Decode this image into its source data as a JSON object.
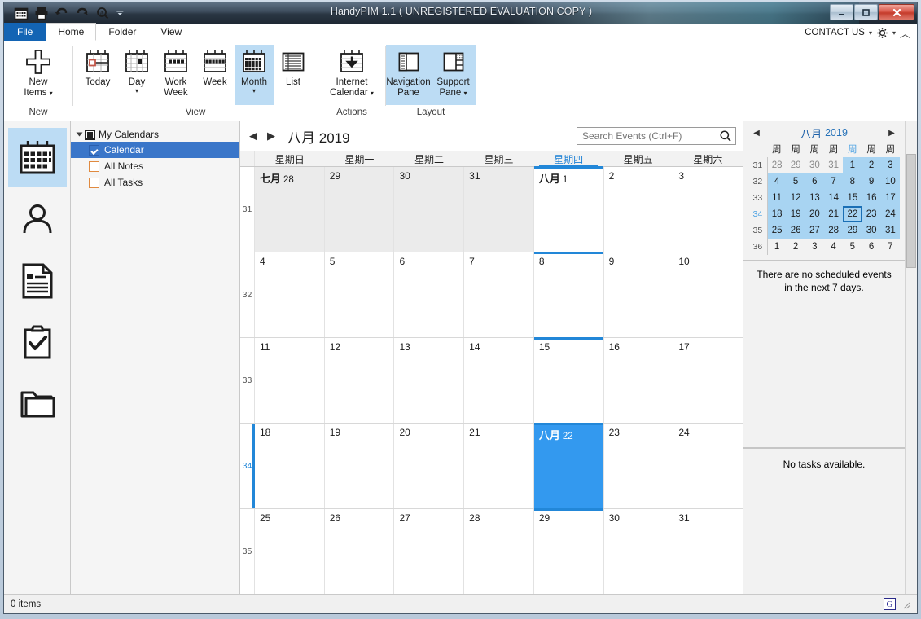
{
  "window": {
    "title": "HandyPIM 1.1 ( UNREGISTERED EVALUATION COPY )",
    "minimize": "—",
    "maximize": "❐",
    "close": "✕"
  },
  "quick_access": [
    {
      "name": "calendar-icon",
      "tip": "Calendar"
    },
    {
      "name": "print-icon",
      "tip": "Print"
    },
    {
      "name": "undo-icon",
      "tip": "Undo"
    },
    {
      "name": "redo-icon",
      "tip": "Redo"
    },
    {
      "name": "find-icon",
      "tip": "Find"
    },
    {
      "name": "customize-qat-icon",
      "tip": "Customize Quick Access Toolbar"
    }
  ],
  "tabs": [
    {
      "label": "File",
      "id": "file",
      "active": false
    },
    {
      "label": "Home",
      "id": "home",
      "active": true
    },
    {
      "label": "Folder",
      "id": "folder",
      "active": false
    },
    {
      "label": "View",
      "id": "view",
      "active": false
    }
  ],
  "ribbon_right": {
    "contact_us": "CONTACT US",
    "caret": "▾",
    "collapse": "︿"
  },
  "ribbon": {
    "groups": [
      {
        "label": "New",
        "buttons": [
          {
            "label_line1": "New",
            "label_line2": "Items",
            "dropdown": true,
            "active": false,
            "icon": "plus-icon"
          }
        ]
      },
      {
        "label": "View",
        "buttons": [
          {
            "label_line1": "Today",
            "label_line2": "",
            "dropdown": false,
            "active": false,
            "icon": "calendar-today-icon"
          },
          {
            "label_line1": "Day",
            "label_line2": "",
            "dropdown": true,
            "active": false,
            "icon": "calendar-day-icon"
          },
          {
            "label_line1": "Work",
            "label_line2": "Week",
            "dropdown": false,
            "active": false,
            "icon": "calendar-workweek-icon"
          },
          {
            "label_line1": "Week",
            "label_line2": "",
            "dropdown": false,
            "active": false,
            "icon": "calendar-week-icon"
          },
          {
            "label_line1": "Month",
            "label_line2": "",
            "dropdown": true,
            "active": true,
            "icon": "calendar-month-icon"
          },
          {
            "label_line1": "List",
            "label_line2": "",
            "dropdown": false,
            "active": false,
            "icon": "list-icon"
          }
        ]
      },
      {
        "label": "Actions",
        "buttons": [
          {
            "label_line1": "Internet",
            "label_line2": "Calendar",
            "dropdown": true,
            "active": false,
            "icon": "calendar-download-icon"
          }
        ]
      },
      {
        "label": "Layout",
        "buttons": [
          {
            "label_line1": "Navigation",
            "label_line2": "Pane",
            "dropdown": false,
            "active": true,
            "icon": "navigation-pane-icon"
          },
          {
            "label_line1": "Support",
            "label_line2": "Pane",
            "dropdown": true,
            "active": true,
            "icon": "support-pane-icon"
          }
        ]
      }
    ]
  },
  "rail": [
    {
      "name": "calendar",
      "icon": "calendar-icon",
      "active": true
    },
    {
      "name": "contacts",
      "icon": "person-icon",
      "active": false
    },
    {
      "name": "notes",
      "icon": "note-icon",
      "active": false
    },
    {
      "name": "tasks",
      "icon": "clipboard-check-icon",
      "active": false
    },
    {
      "name": "folders",
      "icon": "folder-icon",
      "active": false
    }
  ],
  "tree": {
    "root": "My Calendars",
    "items": [
      {
        "label": "Calendar",
        "checked": true,
        "selected": true,
        "color": "#2c63b2"
      },
      {
        "label": "All Notes",
        "checked": false,
        "selected": false,
        "color": "#e08a40"
      },
      {
        "label": "All Tasks",
        "checked": false,
        "selected": false,
        "color": "#e08a40"
      }
    ]
  },
  "calendar": {
    "prev_label": "◀",
    "next_label": "▶",
    "month_label": "八月",
    "year_label": "2019",
    "search": {
      "placeholder": "Search Events (Ctrl+F)",
      "value": ""
    },
    "day_headers": [
      {
        "label": "星期日",
        "today": false
      },
      {
        "label": "星期一",
        "today": false
      },
      {
        "label": "星期二",
        "today": false
      },
      {
        "label": "星期三",
        "today": false
      },
      {
        "label": "星期四",
        "today": true
      },
      {
        "label": "星期五",
        "today": false
      },
      {
        "label": "星期六",
        "today": false
      }
    ],
    "weeks": [
      {
        "week_number": "31",
        "selected": false,
        "days": [
          {
            "month_label": "七月",
            "day": "28",
            "other_month": true,
            "selected": false,
            "today_column": false
          },
          {
            "month_label": "",
            "day": "29",
            "other_month": true,
            "selected": false,
            "today_column": false
          },
          {
            "month_label": "",
            "day": "30",
            "other_month": true,
            "selected": false,
            "today_column": false
          },
          {
            "month_label": "",
            "day": "31",
            "other_month": true,
            "selected": false,
            "today_column": false
          },
          {
            "month_label": "八月",
            "day": "1",
            "other_month": false,
            "selected": false,
            "today_column": true
          },
          {
            "month_label": "",
            "day": "2",
            "other_month": false,
            "selected": false,
            "today_column": false
          },
          {
            "month_label": "",
            "day": "3",
            "other_month": false,
            "selected": false,
            "today_column": false
          }
        ]
      },
      {
        "week_number": "32",
        "selected": false,
        "days": [
          {
            "month_label": "",
            "day": "4",
            "other_month": false,
            "selected": false,
            "today_column": false
          },
          {
            "month_label": "",
            "day": "5",
            "other_month": false,
            "selected": false,
            "today_column": false
          },
          {
            "month_label": "",
            "day": "6",
            "other_month": false,
            "selected": false,
            "today_column": false
          },
          {
            "month_label": "",
            "day": "7",
            "other_month": false,
            "selected": false,
            "today_column": false
          },
          {
            "month_label": "",
            "day": "8",
            "other_month": false,
            "selected": false,
            "today_column": true
          },
          {
            "month_label": "",
            "day": "9",
            "other_month": false,
            "selected": false,
            "today_column": false
          },
          {
            "month_label": "",
            "day": "10",
            "other_month": false,
            "selected": false,
            "today_column": false
          }
        ]
      },
      {
        "week_number": "33",
        "selected": false,
        "days": [
          {
            "month_label": "",
            "day": "11",
            "other_month": false,
            "selected": false,
            "today_column": false
          },
          {
            "month_label": "",
            "day": "12",
            "other_month": false,
            "selected": false,
            "today_column": false
          },
          {
            "month_label": "",
            "day": "13",
            "other_month": false,
            "selected": false,
            "today_column": false
          },
          {
            "month_label": "",
            "day": "14",
            "other_month": false,
            "selected": false,
            "today_column": false
          },
          {
            "month_label": "",
            "day": "15",
            "other_month": false,
            "selected": false,
            "today_column": true
          },
          {
            "month_label": "",
            "day": "16",
            "other_month": false,
            "selected": false,
            "today_column": false
          },
          {
            "month_label": "",
            "day": "17",
            "other_month": false,
            "selected": false,
            "today_column": false
          }
        ]
      },
      {
        "week_number": "34",
        "selected": true,
        "days": [
          {
            "month_label": "",
            "day": "18",
            "other_month": false,
            "selected": false,
            "today_column": false
          },
          {
            "month_label": "",
            "day": "19",
            "other_month": false,
            "selected": false,
            "today_column": false
          },
          {
            "month_label": "",
            "day": "20",
            "other_month": false,
            "selected": false,
            "today_column": false
          },
          {
            "month_label": "",
            "day": "21",
            "other_month": false,
            "selected": false,
            "today_column": false
          },
          {
            "month_label": "八月",
            "day": "22",
            "other_month": false,
            "selected": true,
            "today_column": true
          },
          {
            "month_label": "",
            "day": "23",
            "other_month": false,
            "selected": false,
            "today_column": false
          },
          {
            "month_label": "",
            "day": "24",
            "other_month": false,
            "selected": false,
            "today_column": false
          }
        ]
      },
      {
        "week_number": "35",
        "selected": false,
        "days": [
          {
            "month_label": "",
            "day": "25",
            "other_month": false,
            "selected": false,
            "today_column": false
          },
          {
            "month_label": "",
            "day": "26",
            "other_month": false,
            "selected": false,
            "today_column": false
          },
          {
            "month_label": "",
            "day": "27",
            "other_month": false,
            "selected": false,
            "today_column": false
          },
          {
            "month_label": "",
            "day": "28",
            "other_month": false,
            "selected": false,
            "today_column": false
          },
          {
            "month_label": "",
            "day": "29",
            "other_month": false,
            "selected": false,
            "today_column": true
          },
          {
            "month_label": "",
            "day": "30",
            "other_month": false,
            "selected": false,
            "today_column": false
          },
          {
            "month_label": "",
            "day": "31",
            "other_month": false,
            "selected": false,
            "today_column": false
          }
        ]
      }
    ]
  },
  "support_pane": {
    "mini_calendar": {
      "prev": "◀",
      "next": "▶",
      "month": "八月",
      "year": "2019",
      "day_headers": [
        {
          "label": "周",
          "highlight": false
        },
        {
          "label": "周",
          "highlight": false
        },
        {
          "label": "周",
          "highlight": false
        },
        {
          "label": "周",
          "highlight": false
        },
        {
          "label": "周",
          "highlight": true
        },
        {
          "label": "周",
          "highlight": false
        },
        {
          "label": "周",
          "highlight": false
        }
      ],
      "rows": [
        {
          "week_number": "31",
          "wn_highlight": false,
          "days": [
            {
              "d": "28",
              "dim": true,
              "in_month": false,
              "today": false
            },
            {
              "d": "29",
              "dim": true,
              "in_month": false,
              "today": false
            },
            {
              "d": "30",
              "dim": true,
              "in_month": false,
              "today": false
            },
            {
              "d": "31",
              "dim": true,
              "in_month": false,
              "today": false
            },
            {
              "d": "1",
              "dim": false,
              "in_month": true,
              "today": false
            },
            {
              "d": "2",
              "dim": false,
              "in_month": true,
              "today": false
            },
            {
              "d": "3",
              "dim": false,
              "in_month": true,
              "today": false
            }
          ]
        },
        {
          "week_number": "32",
          "wn_highlight": false,
          "days": [
            {
              "d": "4",
              "dim": false,
              "in_month": true,
              "today": false
            },
            {
              "d": "5",
              "dim": false,
              "in_month": true,
              "today": false
            },
            {
              "d": "6",
              "dim": false,
              "in_month": true,
              "today": false
            },
            {
              "d": "7",
              "dim": false,
              "in_month": true,
              "today": false
            },
            {
              "d": "8",
              "dim": false,
              "in_month": true,
              "today": false
            },
            {
              "d": "9",
              "dim": false,
              "in_month": true,
              "today": false
            },
            {
              "d": "10",
              "dim": false,
              "in_month": true,
              "today": false
            }
          ]
        },
        {
          "week_number": "33",
          "wn_highlight": false,
          "days": [
            {
              "d": "11",
              "dim": false,
              "in_month": true,
              "today": false
            },
            {
              "d": "12",
              "dim": false,
              "in_month": true,
              "today": false
            },
            {
              "d": "13",
              "dim": false,
              "in_month": true,
              "today": false
            },
            {
              "d": "14",
              "dim": false,
              "in_month": true,
              "today": false
            },
            {
              "d": "15",
              "dim": false,
              "in_month": true,
              "today": false
            },
            {
              "d": "16",
              "dim": false,
              "in_month": true,
              "today": false
            },
            {
              "d": "17",
              "dim": false,
              "in_month": true,
              "today": false
            }
          ]
        },
        {
          "week_number": "34",
          "wn_highlight": true,
          "days": [
            {
              "d": "18",
              "dim": false,
              "in_month": true,
              "today": false
            },
            {
              "d": "19",
              "dim": false,
              "in_month": true,
              "today": false
            },
            {
              "d": "20",
              "dim": false,
              "in_month": true,
              "today": false
            },
            {
              "d": "21",
              "dim": false,
              "in_month": true,
              "today": false
            },
            {
              "d": "22",
              "dim": false,
              "in_month": true,
              "today": true
            },
            {
              "d": "23",
              "dim": false,
              "in_month": true,
              "today": false
            },
            {
              "d": "24",
              "dim": false,
              "in_month": true,
              "today": false
            }
          ]
        },
        {
          "week_number": "35",
          "wn_highlight": false,
          "days": [
            {
              "d": "25",
              "dim": false,
              "in_month": true,
              "today": false
            },
            {
              "d": "26",
              "dim": false,
              "in_month": true,
              "today": false
            },
            {
              "d": "27",
              "dim": false,
              "in_month": true,
              "today": false
            },
            {
              "d": "28",
              "dim": false,
              "in_month": true,
              "today": false
            },
            {
              "d": "29",
              "dim": false,
              "in_month": true,
              "today": false
            },
            {
              "d": "30",
              "dim": false,
              "in_month": true,
              "today": false
            },
            {
              "d": "31",
              "dim": false,
              "in_month": true,
              "today": false
            }
          ]
        },
        {
          "week_number": "36",
          "wn_highlight": false,
          "days": [
            {
              "d": "1",
              "dim": false,
              "in_month": false,
              "today": false
            },
            {
              "d": "2",
              "dim": false,
              "in_month": false,
              "today": false
            },
            {
              "d": "3",
              "dim": false,
              "in_month": false,
              "today": false
            },
            {
              "d": "4",
              "dim": false,
              "in_month": false,
              "today": false
            },
            {
              "d": "5",
              "dim": false,
              "in_month": false,
              "today": false
            },
            {
              "d": "6",
              "dim": false,
              "in_month": false,
              "today": false
            },
            {
              "d": "7",
              "dim": false,
              "in_month": false,
              "today": false
            }
          ]
        }
      ]
    },
    "events_empty": "There are no scheduled events in the next 7 days.",
    "tasks_empty": "No tasks available."
  },
  "status": {
    "items_count": "0 items",
    "badge": "G"
  },
  "colors": {
    "accent_blue": "#2287d8",
    "selected_day": "#3399ef",
    "tree_selection": "#3a76c9",
    "ribbon_active": "#bcdcf4",
    "mini_inmonth": "#a8d4f2",
    "file_tab": "#1364b4"
  }
}
